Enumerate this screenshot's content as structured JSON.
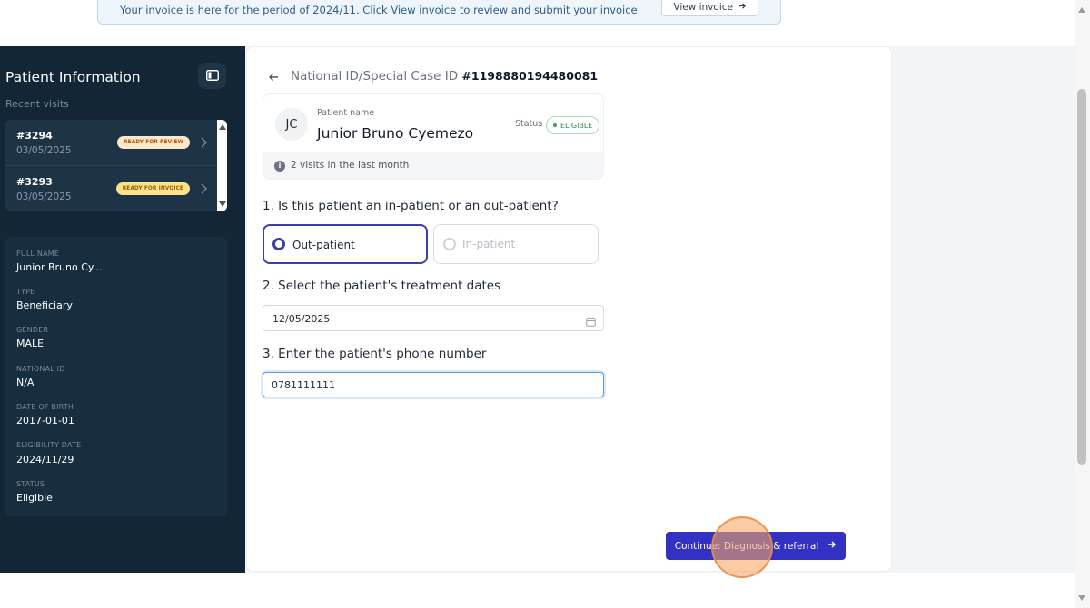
{
  "banner": {
    "text": "Your invoice is here for the period of 2024/11. Click View invoice to review and submit your invoice",
    "button_label": "View invoice"
  },
  "sidebar": {
    "title": "Patient Information",
    "recent_visits_label": "Recent visits",
    "visits": [
      {
        "id": "#3294",
        "date": "03/05/2025",
        "badge": "READY FOR REVIEW"
      },
      {
        "id": "#3293",
        "date": "03/05/2025",
        "badge": "READY FOR INVOICE"
      }
    ],
    "details": [
      {
        "label": "FULL NAME",
        "value": "Junior Bruno Cy..."
      },
      {
        "label": "TYPE",
        "value": "Beneficiary"
      },
      {
        "label": "GENDER",
        "value": "MALE"
      },
      {
        "label": "NATIONAL ID",
        "value": "N/A"
      },
      {
        "label": "DATE OF BIRTH",
        "value": "2017-01-01"
      },
      {
        "label": "ELIGIBILITY DATE",
        "value": "2024/11/29"
      },
      {
        "label": "STATUS",
        "value": "Eligible"
      }
    ]
  },
  "main": {
    "id_label": "National ID/Special Case ID",
    "id_value": "#1198880194480081",
    "patient": {
      "initials": "JC",
      "name_label": "Patient name",
      "name": "Junior Bruno Cyemezo",
      "status_label": "Status",
      "status": "ELIGIBLE",
      "visits_note": "2 visits in the last month"
    },
    "q1": "1. Is this patient an in-patient or an out-patient?",
    "q1_options": [
      "Out-patient",
      "In-patient"
    ],
    "q1_selected": "Out-patient",
    "q2": "2. Select the patient's treatment dates",
    "treatment_date": "12/05/2025",
    "q3": "3. Enter the patient's phone number",
    "phone": "0781111111",
    "continue_label": "Continue: Diagnosis & referral"
  },
  "colors": {
    "sidebar_bg": "#132637",
    "primary": "#3331c4",
    "selected_border": "#3b3fa8",
    "eligible_green": "#2f8a57"
  }
}
